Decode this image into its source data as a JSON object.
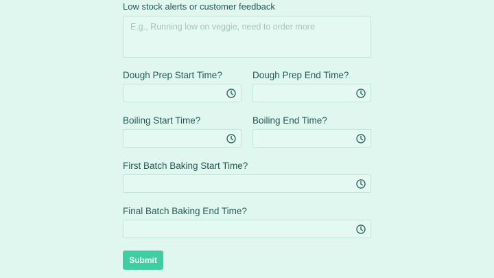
{
  "notes": {
    "label": "Low stock alerts or customer feedback",
    "placeholder": "E.g., Running low on veggie, need to order more",
    "value": ""
  },
  "fields": {
    "dough_prep_start": {
      "label": "Dough Prep Start Time?",
      "value": ""
    },
    "dough_prep_end": {
      "label": "Dough Prep End Time?",
      "value": ""
    },
    "boiling_start": {
      "label": "Boiling Start Time?",
      "value": ""
    },
    "boiling_end": {
      "label": "Boiling End Time?",
      "value": ""
    },
    "first_batch_baking_start": {
      "label": "First Batch Baking Start Time?",
      "value": ""
    },
    "final_batch_baking_end": {
      "label": "Final Batch Baking End Time?",
      "value": ""
    }
  },
  "icons": {
    "time_picker": "clock-icon"
  },
  "submit": {
    "label": "Submit"
  },
  "colors": {
    "background": "#dff7ef",
    "field_border": "#bfe6da",
    "text": "#235c4f",
    "accent": "#3ecfa0"
  }
}
